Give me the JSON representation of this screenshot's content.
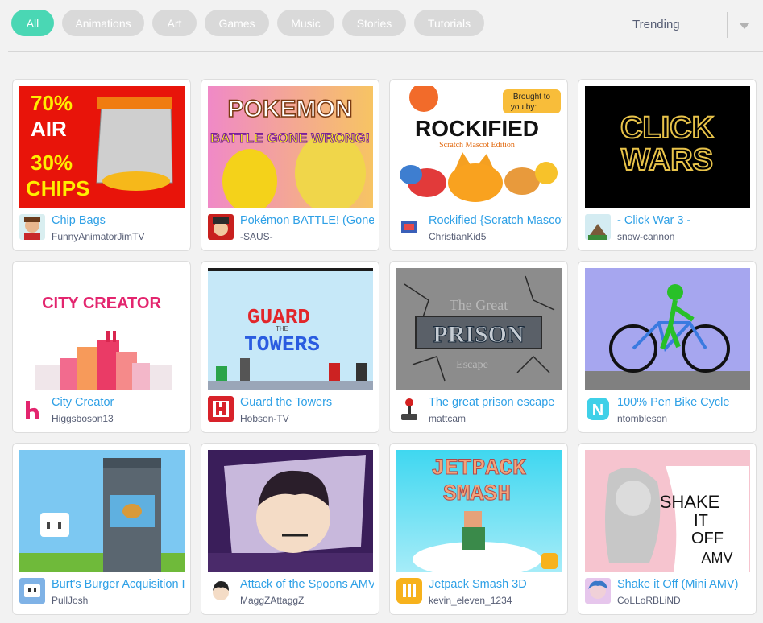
{
  "filters": [
    "All",
    "Animations",
    "Art",
    "Games",
    "Music",
    "Stories",
    "Tutorials"
  ],
  "sort": {
    "selected": "Trending"
  },
  "projects": [
    {
      "title": "Chip Bags",
      "author": "FunnyAnimatorJimTV",
      "thumb_text": [
        "70%",
        "AIR",
        "30%",
        "CHIPS"
      ]
    },
    {
      "title": "Pokémon BATTLE! (Gone Wrong)",
      "author": "-SAUS-",
      "thumb_text": [
        "POKEMON",
        "BATTLE GONE WRONG!"
      ]
    },
    {
      "title": "Rockified {Scratch Mascot Edition}",
      "author": "ChristianKid5",
      "thumb_text": [
        "ROCKIFIED",
        "Scratch Mascot Edition",
        "Brought to",
        "you by:"
      ]
    },
    {
      "title": "- Click War 3 -",
      "author": "snow-cannon",
      "thumb_text": [
        "CLICK",
        "WARS"
      ]
    },
    {
      "title": "City Creator",
      "author": "Higgsboson13",
      "thumb_text": [
        "CITY CREATOR"
      ]
    },
    {
      "title": "Guard the Towers",
      "author": "Hobson-TV",
      "thumb_text": [
        "GUARD",
        "THE",
        "TOWERS"
      ]
    },
    {
      "title": "The great prison escape",
      "author": "mattcam",
      "thumb_text": [
        "The Great",
        "PRISON",
        "Escape"
      ]
    },
    {
      "title": "100% Pen Bike Cycle",
      "author": "ntombleson",
      "thumb_text": []
    },
    {
      "title": "Burt's Burger Acquisition I",
      "author": "PullJosh",
      "thumb_text": []
    },
    {
      "title": "Attack of the Spoons AMV",
      "author": "MaggZAttaggZ",
      "thumb_text": []
    },
    {
      "title": "Jetpack Smash 3D",
      "author": "kevin_eleven_1234",
      "thumb_text": [
        "JETPACK",
        "SMASH"
      ]
    },
    {
      "title": "Shake it Off (Mini AMV)",
      "author": "CoLLoRBLiND",
      "thumb_text": [
        "SHAKE",
        "IT",
        "OFF",
        "AMV"
      ]
    }
  ]
}
